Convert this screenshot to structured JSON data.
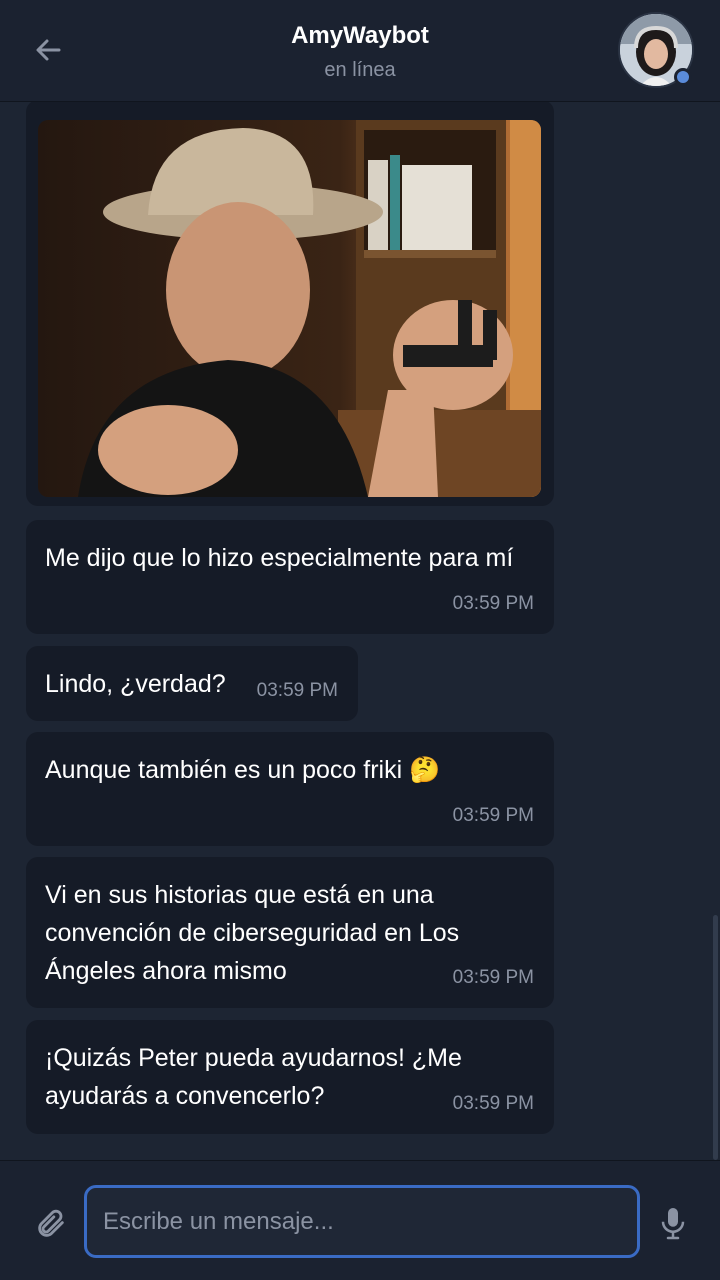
{
  "header": {
    "title": "AmyWaybot",
    "status": "en línea"
  },
  "messages": [
    {
      "type": "image",
      "icon": "photo"
    },
    {
      "text": "Me dijo que lo hizo especialmente para mí",
      "time": "03:59 PM"
    },
    {
      "text": "Lindo, ¿verdad?",
      "time": "03:59 PM"
    },
    {
      "text": "Aunque también es un poco friki",
      "emoji": "🤔",
      "time": "03:59 PM"
    },
    {
      "text": "Vi en sus historias que está en una convención de ciberseguridad en Los Ángeles ahora mismo",
      "time": "03:59 PM"
    },
    {
      "text": "¡Quizás Peter pueda ayudarnos! ¿Me ayudarás a convencerlo?",
      "time": "03:59 PM"
    }
  ],
  "composer": {
    "placeholder": "Escribe un mensaje...",
    "attach_icon": "paperclip-icon",
    "mic_icon": "microphone-icon"
  },
  "colors": {
    "background": "#1d2533",
    "bubble": "#151b27",
    "accent": "#3a6bc4",
    "muted_text": "#8b93a3"
  }
}
